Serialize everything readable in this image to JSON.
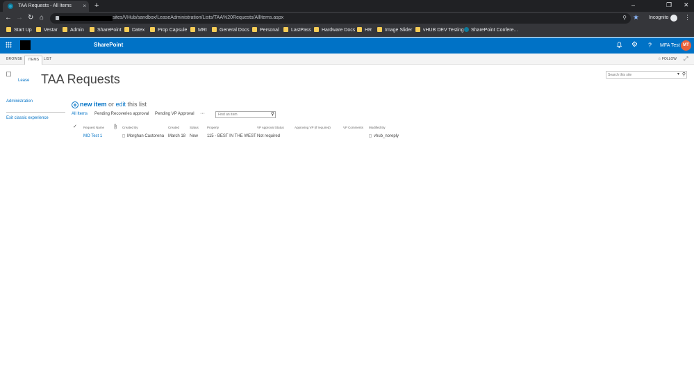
{
  "browser": {
    "tab_title": "TAA Requests - All Items",
    "tab_close": "×",
    "new_tab": "+",
    "window_controls": [
      "–",
      "❐",
      "✕"
    ],
    "nav": {
      "back": "←",
      "forward": "→",
      "reload": "↻",
      "home": "⌂"
    },
    "url": "sites/VHub/sandbox/LeaseAdministration/Lists/TAA%20Requests/AllItems.aspx",
    "zoom_icon": "zoom-icon",
    "star_icon": "★",
    "profile_label": "Incognito",
    "menu_icon": "⋮",
    "bookmarks": [
      {
        "label": "Start Up",
        "icon": "folder"
      },
      {
        "label": "Vestar",
        "icon": "folder"
      },
      {
        "label": "Admin",
        "icon": "folder"
      },
      {
        "label": "SharePoint",
        "icon": "folder"
      },
      {
        "label": "Datex",
        "icon": "folder"
      },
      {
        "label": "Prop Capsule",
        "icon": "folder"
      },
      {
        "label": "MRI",
        "icon": "folder"
      },
      {
        "label": "General Docs",
        "icon": "folder"
      },
      {
        "label": "Personal",
        "icon": "folder"
      },
      {
        "label": "LastPass",
        "icon": "folder"
      },
      {
        "label": "Hardware Docs",
        "icon": "folder"
      },
      {
        "label": "HR",
        "icon": "folder"
      },
      {
        "label": "Image Slider",
        "icon": "folder"
      },
      {
        "label": "vHUB DEV Testing",
        "icon": "folder"
      },
      {
        "label": "SharePoint Confere...",
        "icon": "sharepoint"
      }
    ]
  },
  "suitebar": {
    "brand": "SharePoint",
    "icons": [
      "bell-icon",
      "gear-icon",
      "help-icon"
    ],
    "icon_glyphs": [
      "🔔",
      "⚙",
      "?"
    ],
    "user_name": "MFA Test",
    "user_initials": "MT",
    "accent": "#0072c6",
    "avatar_color": "#e8613a"
  },
  "ribbon": {
    "tabs": [
      "BROWSE",
      "ITEMS",
      "LIST"
    ],
    "active_tab": "ITEMS",
    "follow": "FOLLOW",
    "follow_icon": "☆",
    "focus_icon": "⤢"
  },
  "page": {
    "logo_alt": "Lease",
    "title": "TAA Requests",
    "search_placeholder": "Search this site",
    "search_dropdown": "▾",
    "search_icon": "⚲"
  },
  "quicklaunch": [
    {
      "label": "Administration"
    },
    {
      "label": "Exit classic experience"
    }
  ],
  "list": {
    "new_item_plus": "+",
    "new_item": "new item",
    "or": " or ",
    "edit": "edit",
    "this_list": " this list",
    "views": [
      "All Items",
      "Pending Recoveries approval",
      "Pending VP Approval"
    ],
    "view_more": "···",
    "find_placeholder": "Find an item",
    "find_icon": "⚲",
    "check_glyph": "✓",
    "attach_glyph": "📎",
    "columns": [
      "Request Name",
      "Created By",
      "Created",
      "Status",
      "Property",
      "VP Approval Status",
      "Approving VP (if required)",
      "VP Comments",
      "Modified By"
    ],
    "rows": [
      {
        "request_name": "MO Test 1",
        "created_by": "Morghan Castorena",
        "created": "March 18",
        "status": "New",
        "property": "115 - BEST IN THE WEST",
        "vp_approval_status": "Not required",
        "approving_vp": "",
        "vp_comments": "",
        "modified_by": "vhub_noreply"
      }
    ]
  }
}
